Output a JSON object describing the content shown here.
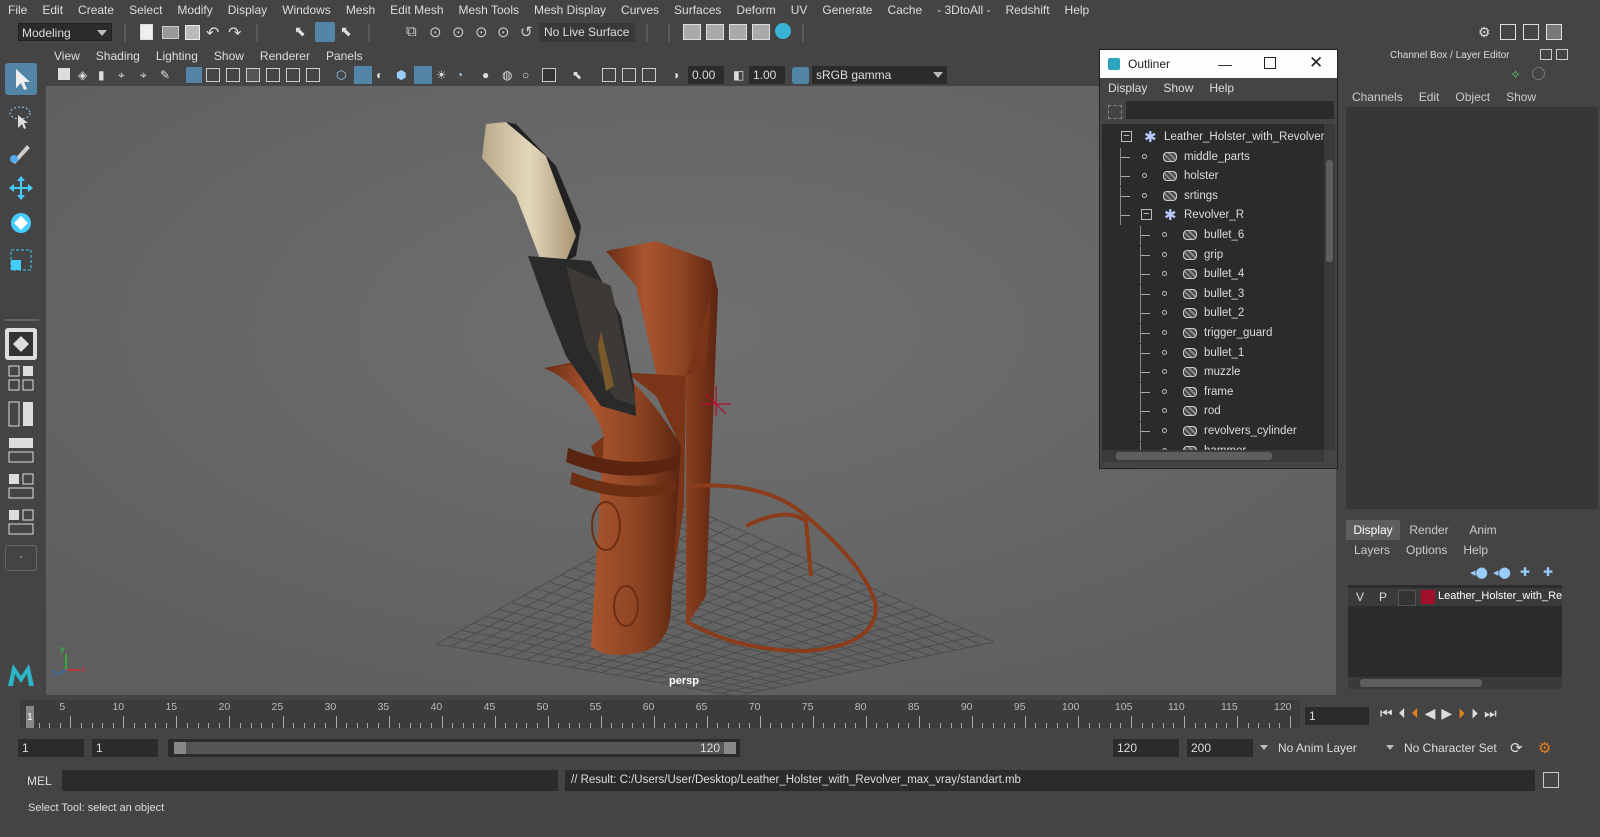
{
  "menubar": {
    "items": [
      "File",
      "Edit",
      "Create",
      "Select",
      "Modify",
      "Display",
      "Windows",
      "Mesh",
      "Edit Mesh",
      "Mesh Tools",
      "Mesh Display",
      "Curves",
      "Surfaces",
      "Deform",
      "UV",
      "Generate",
      "Cache",
      "- 3DtoAll -",
      "Redshift",
      "Help"
    ]
  },
  "shelf": {
    "mode": "Modeling",
    "live_surface": "No Live Surface"
  },
  "viewport": {
    "menu": [
      "View",
      "Shading",
      "Lighting",
      "Show",
      "Renderer",
      "Panels"
    ],
    "exposure": "0.00",
    "gamma": "1.00",
    "color_space": "sRGB gamma",
    "camera_label": "persp",
    "axis_x": "x",
    "axis_y": "y",
    "axis_z": "z"
  },
  "outliner": {
    "title": "Outliner",
    "menu": [
      "Display",
      "Show",
      "Help"
    ],
    "tree": [
      {
        "label": "Leather_Holster_with_Revolver_",
        "depth": 0,
        "kind": "group",
        "expanded": true
      },
      {
        "label": "middle_parts",
        "depth": 1,
        "kind": "mesh"
      },
      {
        "label": "holster",
        "depth": 1,
        "kind": "mesh"
      },
      {
        "label": "srtings",
        "depth": 1,
        "kind": "mesh"
      },
      {
        "label": "Revolver_R",
        "depth": 1,
        "kind": "group",
        "expanded": true
      },
      {
        "label": "bullet_6",
        "depth": 2,
        "kind": "mesh"
      },
      {
        "label": "grip",
        "depth": 2,
        "kind": "mesh"
      },
      {
        "label": "bullet_4",
        "depth": 2,
        "kind": "mesh"
      },
      {
        "label": "bullet_3",
        "depth": 2,
        "kind": "mesh"
      },
      {
        "label": "bullet_2",
        "depth": 2,
        "kind": "mesh"
      },
      {
        "label": "trigger_guard",
        "depth": 2,
        "kind": "mesh"
      },
      {
        "label": "bullet_1",
        "depth": 2,
        "kind": "mesh"
      },
      {
        "label": "muzzle",
        "depth": 2,
        "kind": "mesh"
      },
      {
        "label": "frame",
        "depth": 2,
        "kind": "mesh"
      },
      {
        "label": "rod",
        "depth": 2,
        "kind": "mesh"
      },
      {
        "label": "revolvers_cylinder",
        "depth": 2,
        "kind": "mesh"
      },
      {
        "label": "hammer",
        "depth": 2,
        "kind": "mesh"
      }
    ]
  },
  "channel_box": {
    "title": "Channel Box / Layer Editor",
    "menu": [
      "Channels",
      "Edit",
      "Object",
      "Show"
    ],
    "tabs": [
      "Display",
      "Render",
      "Anim"
    ],
    "active_tab": "Display",
    "layer_menu": [
      "Layers",
      "Options",
      "Help"
    ],
    "layer": {
      "v": "V",
      "p": "P",
      "name": "Leather_Holster_with_Re",
      "color": "#a0102a"
    }
  },
  "timeline": {
    "ticks": [
      5,
      10,
      15,
      20,
      25,
      30,
      35,
      40,
      45,
      50,
      55,
      60,
      65,
      70,
      75,
      80,
      85,
      90,
      95,
      100,
      105,
      110,
      115,
      120
    ],
    "start_label": "1",
    "current_frame": "1"
  },
  "range": {
    "start": "1",
    "anim_start": "1",
    "slider_start": "1",
    "slider_end": "120",
    "end": "120",
    "anim_end": "200",
    "anim_layer": "No Anim Layer",
    "char_set": "No Character Set"
  },
  "command": {
    "lang": "MEL",
    "result": "// Result: C:/Users/User/Desktop/Leather_Holster_with_Revolver_max_vray/standart.mb"
  },
  "help_line": "Select Tool: select an object"
}
